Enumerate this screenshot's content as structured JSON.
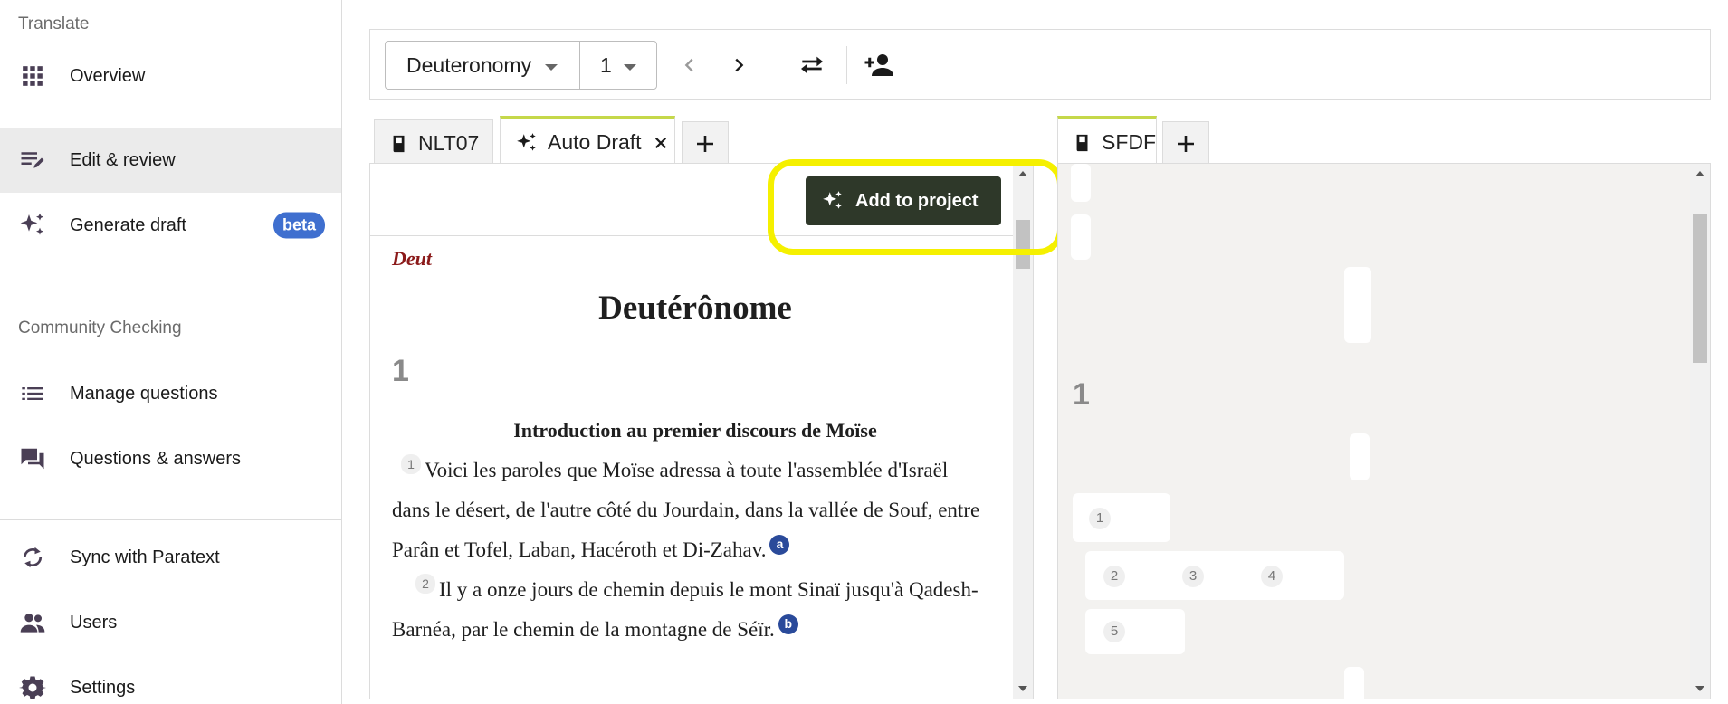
{
  "sidebar": {
    "section_translate": "Translate",
    "section_checking": "Community Checking",
    "items": [
      {
        "label": "Overview",
        "icon": "grid-icon"
      },
      {
        "label": "Edit & review",
        "icon": "edit-notes-icon"
      },
      {
        "label": "Generate draft",
        "icon": "sparkle-icon",
        "badge": "beta"
      },
      {
        "label": "Manage questions",
        "icon": "list-icon"
      },
      {
        "label": "Questions & answers",
        "icon": "forum-icon"
      },
      {
        "label": "Sync with Paratext",
        "icon": "sync-icon"
      },
      {
        "label": "Users",
        "icon": "people-icon"
      },
      {
        "label": "Settings",
        "icon": "gear-icon"
      }
    ],
    "active_item": "Edit & review"
  },
  "toolbar": {
    "book": "Deuteronomy",
    "chapter": "1"
  },
  "left_tabs": [
    {
      "label": "NLT07",
      "icon": "book-icon"
    },
    {
      "label": "Auto Draft",
      "icon": "sparkle-icon",
      "closable": true
    }
  ],
  "right_tabs": [
    {
      "label": "SFDF",
      "icon": "book-icon"
    }
  ],
  "draft": {
    "add_button": "Add to project"
  },
  "scripture": {
    "book_code": "Deut",
    "book_title": "Deutérônome",
    "chapter": "1",
    "section_heading": "Introduction au premier discours de Moïse",
    "verses": [
      {
        "num": "1",
        "text": "Voici les paroles que Moïse adressa à toute l'assemblée d'Israël dans le désert, de l'autre côté du Jourdain, dans la vallée de Souf, entre Parân et Tofel, Laban, Hacéroth et Di-Zahav.",
        "footnote": "a"
      },
      {
        "num": "2",
        "text": "Il y a onze jours de chemin depuis le mont Sinaï jusqu'à Qadesh-Barnéa, par le chemin de la montagne de Séïr.",
        "footnote": "b"
      }
    ]
  },
  "right": {
    "chapter": "1",
    "verse_markers": [
      "1",
      "2",
      "3",
      "4",
      "5"
    ]
  },
  "colors": {
    "add_button_bg": "#2e3829",
    "highlight": "#f5f000",
    "beta_badge": "#3f6fcf",
    "book_code": "#8b1a1a"
  }
}
